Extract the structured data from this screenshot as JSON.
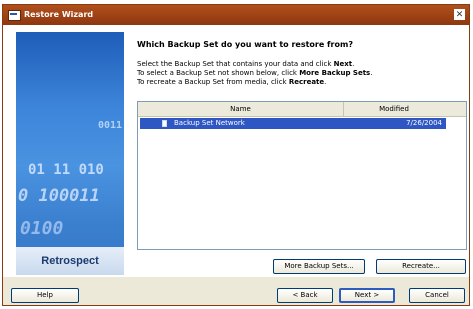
{
  "window": {
    "title": "Restore Wizard",
    "close_glyph": "✕"
  },
  "side_panel": {
    "brand": "Retrospect",
    "digits": [
      "0011",
      "01 11 010",
      "0 100011",
      "0100"
    ]
  },
  "heading": "Which Backup Set do you want to restore from?",
  "instructions": {
    "line1_pre": "Select the Backup Set that contains your data and click ",
    "line1_bold": "Next",
    "line1_post": ".",
    "line2_pre": "To select a Backup Set not shown below, click ",
    "line2_bold": "More Backup Sets",
    "line2_post": ".",
    "line3_pre": "To recreate a Backup Set from media, click ",
    "line3_bold": "Recreate",
    "line3_post": "."
  },
  "list": {
    "columns": [
      "Name",
      "Modified"
    ],
    "rows": [
      {
        "name": "Backup Set Network",
        "modified": "7/26/2004",
        "selected": true
      }
    ]
  },
  "buttons": {
    "more_backup_sets": "More Backup Sets...",
    "recreate": "Recreate...",
    "help": "Help",
    "back": "< Back",
    "next": "Next >",
    "cancel": "Cancel"
  }
}
